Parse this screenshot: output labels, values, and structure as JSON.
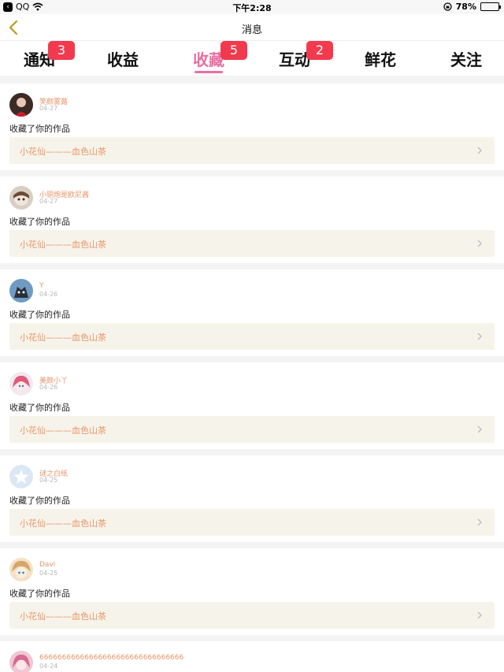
{
  "status_bar": {
    "back_app": "QQ",
    "time": "下午2:28",
    "battery": "78%",
    "battery_level": 0.78
  },
  "nav": {
    "title": "消息"
  },
  "tabs": [
    {
      "label": "通知",
      "badge": "3"
    },
    {
      "label": "收益",
      "badge": ""
    },
    {
      "label": "收藏",
      "badge": "5",
      "active": true
    },
    {
      "label": "互动",
      "badge": "2"
    },
    {
      "label": "鲜花",
      "badge": ""
    },
    {
      "label": "关注",
      "badge": ""
    }
  ],
  "items": [
    {
      "user": "笑颜雾蕗",
      "date": "04-27",
      "action": "收藏了你的作品",
      "work": "小花仙———血色山茶",
      "avatar_icon": "user-avatar-icon"
    },
    {
      "user": "小铜炮是欧尼酱",
      "date": "04-27",
      "action": "收藏了你的作品",
      "work": "小花仙———血色山茶",
      "avatar_icon": "user-avatar-icon"
    },
    {
      "user": "Y",
      "date": "04-26",
      "action": "收藏了你的作品",
      "work": "小花仙———血色山茶",
      "avatar_icon": "user-avatar-icon"
    },
    {
      "user": "美颜小丫",
      "date": "04-26",
      "action": "收藏了你的作品",
      "work": "小花仙———血色山茶",
      "avatar_icon": "user-avatar-icon"
    },
    {
      "user": "谜之白纸",
      "date": "04-25",
      "action": "收藏了你的作品",
      "work": "小花仙———血色山茶",
      "avatar_icon": "default-star-avatar-icon"
    },
    {
      "user": "Davi",
      "date": "04-25",
      "action": "收藏了你的作品",
      "work": "小花仙———血色山茶",
      "avatar_icon": "user-avatar-icon"
    },
    {
      "user": "66666666666666666666666666666666",
      "date": "04-24",
      "action": "",
      "work": "",
      "avatar_icon": "user-avatar-icon"
    }
  ],
  "colors": {
    "accent": "#e86fa3",
    "badge": "#f23a4e",
    "link": "#e8956a",
    "card_bg": "#f6f4ea"
  }
}
